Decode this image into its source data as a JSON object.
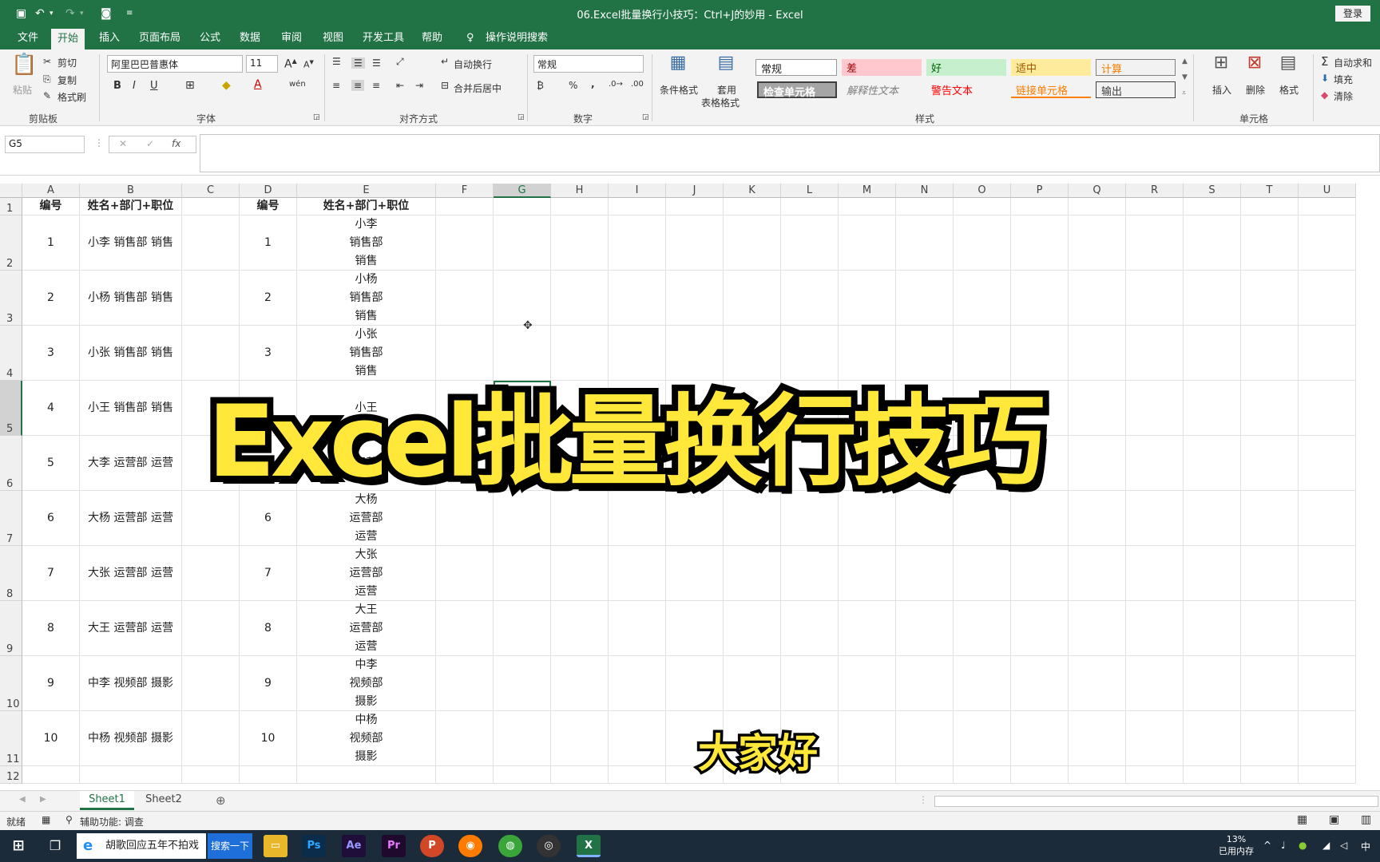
{
  "window": {
    "title": "06.Excel批量换行小技巧：Ctrl+J的妙用  -  Excel",
    "login": "登录"
  },
  "tabs": [
    "文件",
    "开始",
    "插入",
    "页面布局",
    "公式",
    "数据",
    "审阅",
    "视图",
    "开发工具",
    "帮助"
  ],
  "tell_me": "操作说明搜索",
  "ribbon": {
    "clipboard": {
      "paste": "粘贴",
      "cut": "剪切",
      "copy": "复制",
      "painter": "格式刷",
      "group": "剪贴板"
    },
    "font": {
      "name": "阿里巴巴普惠体",
      "size": "11",
      "group": "字体",
      "bold": "B",
      "italic": "I",
      "underline": "U",
      "font_color_glyph": "A",
      "phonetic": "wén"
    },
    "align": {
      "wrap": "自动换行",
      "merge": "合并后居中",
      "group": "对齐方式"
    },
    "number": {
      "format": "常规",
      "percent": "%",
      "comma": ",",
      "group": "数字"
    },
    "styles": {
      "cond": "条件格式",
      "table1": "套用",
      "table2": "表格格式",
      "normal": "常规",
      "bad": "差",
      "good": "好",
      "neutral": "适中",
      "calc": "计算",
      "check": "检查单元格",
      "explan": "解释性文本",
      "warn": "警告文本",
      "linked": "链接单元格",
      "output": "输出",
      "group": "样式"
    },
    "cells": {
      "insert": "插入",
      "delete": "删除",
      "format": "格式",
      "group": "单元格"
    },
    "editing": {
      "autosum": "自动求和",
      "fill": "填充",
      "clear": "清除"
    }
  },
  "formula_bar": {
    "name_box": "G5",
    "fx": "fx",
    "content": ""
  },
  "columns": [
    "A",
    "B",
    "C",
    "D",
    "E",
    "F",
    "G",
    "H",
    "I",
    "J",
    "K",
    "L",
    "M",
    "N",
    "O",
    "P",
    "Q",
    "R",
    "S",
    "T",
    "U"
  ],
  "header_row": {
    "a": "编号",
    "b": "姓名+部门+职位",
    "d": "编号",
    "e": "姓名+部门+职位"
  },
  "rows": [
    {
      "num": "1",
      "b": "小李 销售部 销售",
      "d": "1",
      "e": "小李\n销售部\n销售"
    },
    {
      "num": "2",
      "b": "小杨 销售部 销售",
      "d": "2",
      "e": "小杨\n销售部\n销售"
    },
    {
      "num": "3",
      "b": "小张 销售部 销售",
      "d": "3",
      "e": "小张\n销售部\n销售"
    },
    {
      "num": "4",
      "b": "小王 销售部 销售",
      "d": "",
      "e": "小王"
    },
    {
      "num": "5",
      "b": "大李 运营部 运营",
      "d": "",
      "e": "运营"
    },
    {
      "num": "6",
      "b": "大杨 运营部 运营",
      "d": "6",
      "e": "大杨\n运营部\n运营"
    },
    {
      "num": "7",
      "b": "大张 运营部 运营",
      "d": "7",
      "e": "大张\n运营部\n运营"
    },
    {
      "num": "8",
      "b": "大王 运营部 运营",
      "d": "8",
      "e": "大王\n运营部\n运营"
    },
    {
      "num": "9",
      "b": "中李 视频部 摄影",
      "d": "9",
      "e": "中李\n视频部\n摄影"
    },
    {
      "num": "10",
      "b": "中杨 视频部 摄影",
      "d": "10",
      "e": "中杨\n视频部\n摄影"
    }
  ],
  "row_numbers": [
    "1",
    "2",
    "3",
    "4",
    "5",
    "6",
    "7",
    "8",
    "9",
    "10",
    "11",
    "12"
  ],
  "overlay": {
    "title": "Excel批量换行技巧",
    "subtitle": "大家好"
  },
  "sheets": [
    "Sheet1",
    "Sheet2"
  ],
  "status": {
    "ready": "就绪",
    "accessibility": "辅助功能: 调查"
  },
  "taskbar": {
    "ie_text": "胡歌回应五年不拍戏",
    "search": "搜索一下",
    "mem": "13%",
    "mem_label": "已用内存",
    "ime": "中"
  }
}
